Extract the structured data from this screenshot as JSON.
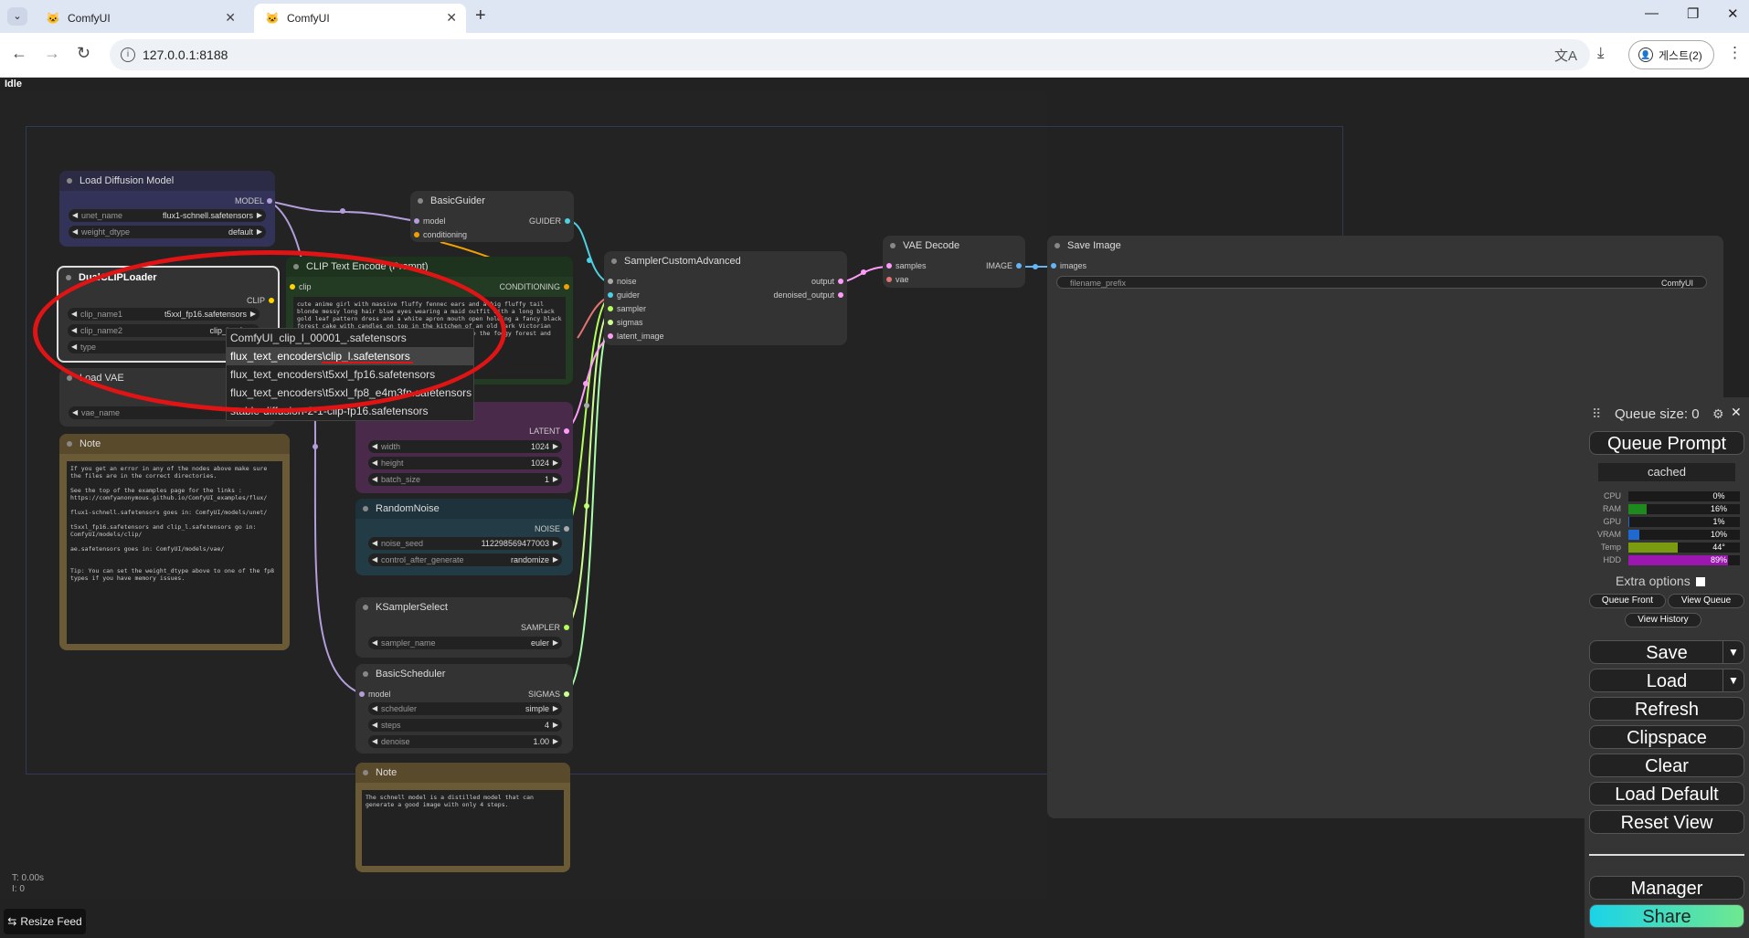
{
  "browser": {
    "tabs": [
      {
        "title": "ComfyUI"
      },
      {
        "title": "ComfyUI"
      }
    ],
    "url": "127.0.0.1:8188",
    "profile": "게스트(2)"
  },
  "status": "Idle",
  "nodes": {
    "load_diffusion": {
      "title": "Load Diffusion Model",
      "output": "MODEL",
      "unet_name_label": "unet_name",
      "unet_name": "flux1-schnell.safetensors",
      "weight_dtype_label": "weight_dtype",
      "weight_dtype": "default"
    },
    "dual_clip": {
      "title": "DualCLIPLoader",
      "output": "CLIP",
      "clip_name1_label": "clip_name1",
      "clip_name1": "t5xxl_fp16.safetensors",
      "clip_name2_label": "clip_name2",
      "clip_name2": "clip_l.safeter",
      "type_label": "type"
    },
    "load_vae": {
      "title": "Load VAE",
      "vae_name_label": "vae_name"
    },
    "basic_guider": {
      "title": "BasicGuider",
      "in_model": "model",
      "in_conditioning": "conditioning",
      "output": "GUIDER"
    },
    "clip_text_encode": {
      "title": "CLIP Text Encode (Prompt)",
      "in_clip": "clip",
      "output": "CONDITIONING",
      "text": "cute anime girl with massive fluffy fennec ears and a big fluffy tail blonde messy long hair blue eyes wearing a maid outfit with a long black gold leaf pattern dress and a white apron mouth open holding a fancy black forest cake with candles on top in the kitchen of an old dark Victorian mansion lit by candlelight with a bright window to the foggy forest and very expensive stuff everywhere"
    },
    "latent": {
      "output": "LATENT",
      "width_label": "width",
      "width": "1024",
      "height_label": "height",
      "height": "1024",
      "batch_label": "batch_size",
      "batch": "1"
    },
    "random_noise": {
      "title": "RandomNoise",
      "output": "NOISE",
      "seed_label": "noise_seed",
      "seed": "112298569477003",
      "control_label": "control_after_generate",
      "control": "randomize"
    },
    "ksampler_select": {
      "title": "KSamplerSelect",
      "output": "SAMPLER",
      "sampler_label": "sampler_name",
      "sampler": "euler"
    },
    "basic_scheduler": {
      "title": "BasicScheduler",
      "in_model": "model",
      "output": "SIGMAS",
      "scheduler_label": "scheduler",
      "scheduler": "simple",
      "steps_label": "steps",
      "steps": "4",
      "denoise_label": "denoise",
      "denoise": "1.00"
    },
    "sampler_custom": {
      "title": "SamplerCustomAdvanced",
      "in_noise": "noise",
      "in_guider": "guider",
      "in_sampler": "sampler",
      "in_sigmas": "sigmas",
      "in_latent": "latent_image",
      "out_output": "output",
      "out_denoised": "denoised_output"
    },
    "vae_decode": {
      "title": "VAE Decode",
      "in_samples": "samples",
      "in_vae": "vae",
      "output": "IMAGE"
    },
    "save_image": {
      "title": "Save Image",
      "in_images": "images",
      "prefix_label": "filename_prefix",
      "prefix": "ComfyUI"
    },
    "note1": {
      "title": "Note",
      "text": "If you get an error in any of the nodes above make sure the files are in the correct directories.\n\nSee the top of the examples page for the links : https://comfyanonymous.github.io/ComfyUI_examples/flux/\n\nflux1-schnell.safetensors goes in: ComfyUI/models/unet/\n\nt5xxl_fp16.safetensors and clip_l.safetensors go in: ComfyUI/models/clip/\n\nae.safetensors goes in: ComfyUI/models/vae/\n\n\nTip: You can set the weight_dtype above to one of the fp8 types if you have memory issues."
    },
    "note2": {
      "title": "Note",
      "text": "The schnell model is a distilled model that can generate a good image with only 4 steps."
    }
  },
  "dropdown": {
    "options": [
      "ComfyUI_clip_l_00001_.safetensors",
      "flux_text_encoders\\clip_l.safetensors",
      "flux_text_encoders\\t5xxl_fp16.safetensors",
      "flux_text_encoders\\t5xxl_fp8_e4m3fn.safetensors",
      "stable-diffusion-2-1-clip-fp16.safetensors"
    ],
    "selected_index": 1
  },
  "canvas_info": {
    "t": "T: 0.00s",
    "i": "I: 0"
  },
  "resize_feed": "Resize Feed",
  "menu": {
    "queue_size": "Queue size: 0",
    "queue_prompt": "Queue Prompt",
    "cached": "cached",
    "stats": [
      {
        "label": "CPU",
        "value": "0%",
        "fraction": 0.0,
        "color": "#1e9f1e"
      },
      {
        "label": "RAM",
        "value": "16%",
        "fraction": 0.16,
        "color": "#1e8a1e"
      },
      {
        "label": "GPU",
        "value": "1%",
        "fraction": 0.01,
        "color": "#1e6ad0"
      },
      {
        "label": "VRAM",
        "value": "10%",
        "fraction": 0.1,
        "color": "#1e6ad0"
      },
      {
        "label": "Temp",
        "value": "44°",
        "fraction": 0.44,
        "color": "#7a9a10"
      },
      {
        "label": "HDD",
        "value": "89%",
        "fraction": 0.89,
        "color": "#9b17b0"
      }
    ],
    "extra_options": "Extra options",
    "queue_front": "Queue Front",
    "view_queue": "View Queue",
    "view_history": "View History",
    "save": "Save",
    "load": "Load",
    "refresh": "Refresh",
    "clipspace": "Clipspace",
    "clear": "Clear",
    "load_default": "Load Default",
    "reset_view": "Reset View",
    "manager": "Manager",
    "share": "Share"
  }
}
